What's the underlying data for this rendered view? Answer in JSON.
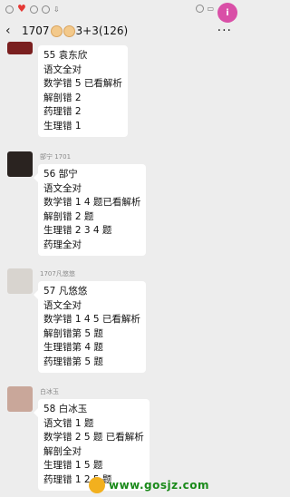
{
  "header": {
    "title_prefix": "1707",
    "title_suffix": "3+3(126)"
  },
  "badge": "i",
  "messages": [
    {
      "sender": "",
      "lines": [
        "55 袁东欣",
        "语文全对",
        "数学错 5  已看解析",
        "解剖错 2",
        "药理错 2",
        "生理错 1"
      ]
    },
    {
      "sender": "郜宁 1701",
      "lines": [
        "56 郜宁",
        "语文全对",
        "数学错 1  4 题已看解析",
        "解剖错 2 题",
        "生理错 2  3  4 题",
        "药理全对"
      ]
    },
    {
      "sender": "1707凡悠悠",
      "lines": [
        "57 凡悠悠",
        "语文全对",
        "数学错 1 4 5  已看解析",
        "解剖错第 5 题",
        "生理错第 4 题",
        "药理错第 5 题"
      ]
    },
    {
      "sender": "白冰玉",
      "lines": [
        "58 白冰玉",
        "语文错 1 题",
        "数学错 2 5 题 已看解析",
        "解剖全对",
        "生理错 1 5 题",
        "药理错 1 2 5 题"
      ]
    }
  ],
  "watermark": "www.gosjz.com",
  "colors": {
    "background": "#ededed",
    "bubble": "#ffffff",
    "badge": "#d94fa7",
    "watermark": "#1a8a1a"
  }
}
